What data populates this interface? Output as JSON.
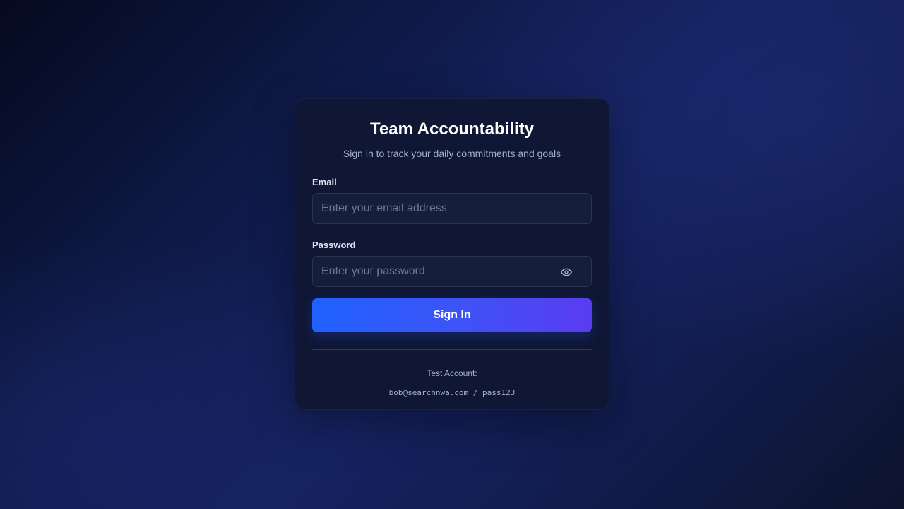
{
  "login": {
    "title": "Team Accountability",
    "subtitle": "Sign in to track your daily commitments and goals",
    "email": {
      "label": "Email",
      "value": "",
      "placeholder": "Enter your email address"
    },
    "password": {
      "label": "Password",
      "value": "",
      "placeholder": "Enter your password",
      "toggle_icon": "eye-icon"
    },
    "submit_label": "Sign In",
    "test_account": {
      "label": "Test Account:",
      "credentials": "bob@searchnwa.com / pass123"
    }
  },
  "colors": {
    "accent_start": "#1f61ff",
    "accent_end": "#5a3cf0",
    "card_bg": "#0f1734",
    "input_bg": "#161f3a"
  }
}
